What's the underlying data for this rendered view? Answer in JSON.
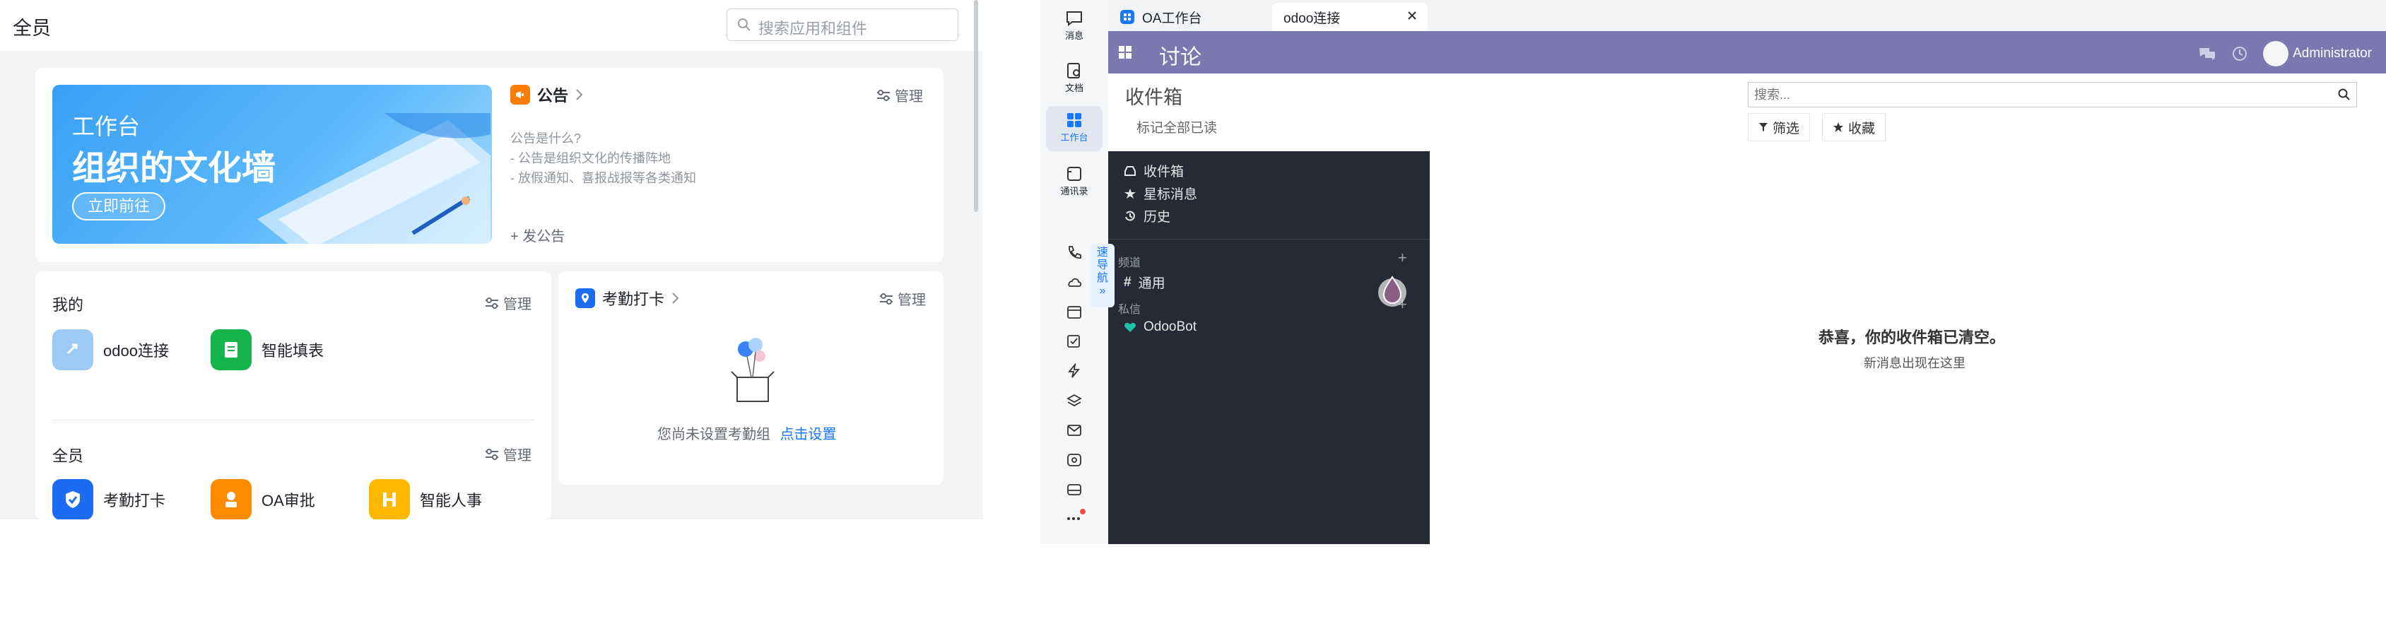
{
  "left": {
    "title": "全员",
    "search_placeholder": "搜索应用和组件",
    "banner": {
      "line1": "工作台",
      "line2": "组织的文化墙",
      "button": "立即前往"
    },
    "announcement": {
      "title": "公告",
      "manage": "管理",
      "lines": [
        "公告是什么?",
        "- 公告是组织文化的传播阵地",
        "- 放假通知、喜报战报等各类通知"
      ],
      "post": "发公告"
    },
    "my_apps": {
      "title": "我的",
      "manage": "管理",
      "items": [
        {
          "label": "odoo连接",
          "color": "#9ccaf5"
        },
        {
          "label": "智能填表",
          "color": "#14b34c"
        }
      ]
    },
    "all_apps": {
      "title": "全员",
      "manage": "管理",
      "items": [
        {
          "label": "考勤打卡",
          "color": "#1b6cf2"
        },
        {
          "label": "OA审批",
          "color": "#ff8a00"
        },
        {
          "label": "智能人事",
          "color": "#ffb800"
        }
      ]
    },
    "attendance": {
      "title": "考勤打卡",
      "manage": "管理",
      "empty_text": "您尚未设置考勤组",
      "link": "点击设置"
    }
  },
  "right": {
    "sidebar": [
      {
        "label": "消息",
        "icon": "message-icon"
      },
      {
        "label": "文档",
        "icon": "document-icon"
      },
      {
        "label": "工作台",
        "icon": "workbench-icon"
      },
      {
        "label": "通讯录",
        "icon": "contacts-icon"
      }
    ],
    "quick_nav": "速导航",
    "tabs": [
      {
        "label": "OA工作台"
      },
      {
        "label": "odoo连接"
      }
    ],
    "odoo": {
      "title": "讨论",
      "user": "Administrator"
    },
    "control": {
      "title": "收件箱",
      "mark_all": "标记全部已读",
      "search_placeholder": "搜索...",
      "filter": "筛选",
      "favorite": "收藏"
    },
    "mail_sidebar": {
      "inbox": "收件箱",
      "starred": "星标消息",
      "history": "历史",
      "channels_label": "频道",
      "general": "通用",
      "dm_label": "私信",
      "bot": "OdooBot"
    },
    "empty": {
      "title": "恭喜，你的收件箱已清空。",
      "subtitle": "新消息出现在这里"
    },
    "colors": {
      "odoo_purple": "#7b78b0",
      "sidebar_dark": "#262a36",
      "accent_blue": "#1677ff"
    }
  }
}
